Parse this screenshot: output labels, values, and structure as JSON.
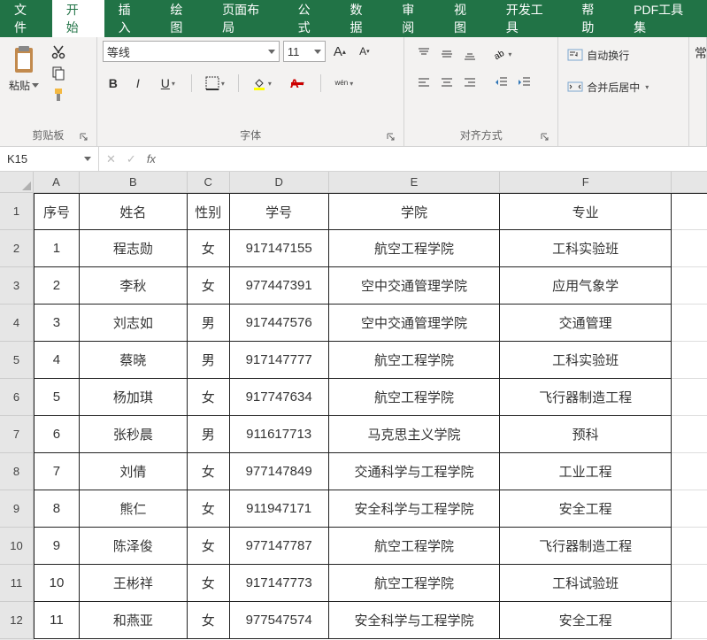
{
  "ribbon": {
    "tabs": [
      "文件",
      "开始",
      "插入",
      "绘图",
      "页面布局",
      "公式",
      "数据",
      "审阅",
      "视图",
      "开发工具",
      "帮助",
      "PDF工具集"
    ],
    "activeTab": 1,
    "groups": {
      "clipboard": {
        "paste": "粘贴",
        "label": "剪贴板"
      },
      "font": {
        "name": "等线",
        "size": "11",
        "bold": "B",
        "italic": "I",
        "underline": "U",
        "label": "字体",
        "wen": "wén"
      },
      "align": {
        "label": "对齐方式"
      },
      "wrap": {
        "autoWrap": "自动换行",
        "merge": "合并后居中"
      }
    }
  },
  "formulaBar": {
    "nameBox": "K15",
    "fx": "fx"
  },
  "grid": {
    "columns": [
      "A",
      "B",
      "C",
      "D",
      "E",
      "F"
    ],
    "rowNumbers": [
      "1",
      "2",
      "3",
      "4",
      "5",
      "6",
      "7",
      "8",
      "9",
      "10",
      "11",
      "12"
    ],
    "header": [
      "序号",
      "姓名",
      "性别",
      "学号",
      "学院",
      "专业"
    ],
    "rows": [
      [
        "1",
        "程志勋",
        "女",
        "917147155",
        "航空工程学院",
        "工科实验班"
      ],
      [
        "2",
        "李秋",
        "女",
        "977447391",
        "空中交通管理学院",
        "应用气象学"
      ],
      [
        "3",
        "刘志如",
        "男",
        "917447576",
        "空中交通管理学院",
        "交通管理"
      ],
      [
        "4",
        "蔡晓",
        "男",
        "917147777",
        "航空工程学院",
        "工科实验班"
      ],
      [
        "5",
        "杨加琪",
        "女",
        "917747634",
        "航空工程学院",
        "飞行器制造工程"
      ],
      [
        "6",
        "张秒晨",
        "男",
        "911617713",
        "马克思主义学院",
        "预科"
      ],
      [
        "7",
        "刘倩",
        "女",
        "977147849",
        "交通科学与工程学院",
        "工业工程"
      ],
      [
        "8",
        "熊仁",
        "女",
        "911947171",
        "安全科学与工程学院",
        "安全工程"
      ],
      [
        "9",
        "陈泽俊",
        "女",
        "977147787",
        "航空工程学院",
        "飞行器制造工程"
      ],
      [
        "10",
        "王彬祥",
        "女",
        "917147773",
        "航空工程学院",
        "工科试验班"
      ],
      [
        "11",
        "和燕亚",
        "女",
        "977547574",
        "安全科学与工程学院",
        "安全工程"
      ]
    ]
  }
}
